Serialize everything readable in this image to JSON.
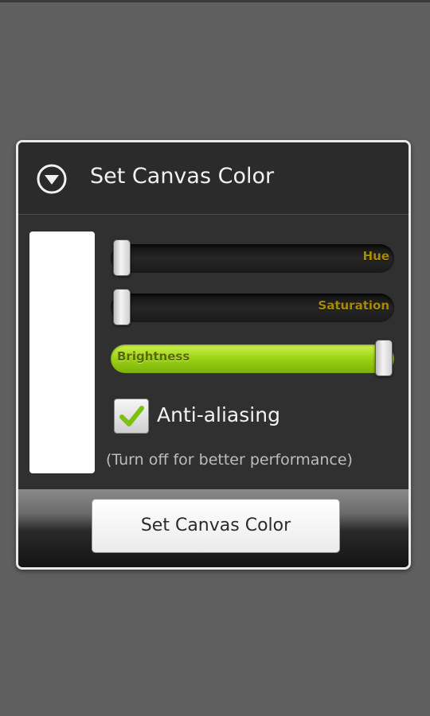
{
  "dialog": {
    "title": "Set Canvas Color",
    "header_icon": "chevron-down-circle-icon"
  },
  "sliders": {
    "hue": {
      "label": "Hue",
      "level": 0.0
    },
    "saturation": {
      "label": "Saturation",
      "level": 0.0
    },
    "brightness": {
      "label": "Brightness",
      "level": 1.0
    }
  },
  "options": {
    "anti_aliasing_label": "Anti-aliasing",
    "anti_aliasing_checked": true,
    "hint": "(Turn off for better performance)"
  },
  "footer": {
    "button_label": "Set Canvas Color"
  },
  "preview_color": "#ffffff",
  "colors": {
    "background": "#5f5f5f",
    "dialog": "#303030",
    "accent_green": "#9ad214",
    "label_gold": "#a78a00"
  }
}
